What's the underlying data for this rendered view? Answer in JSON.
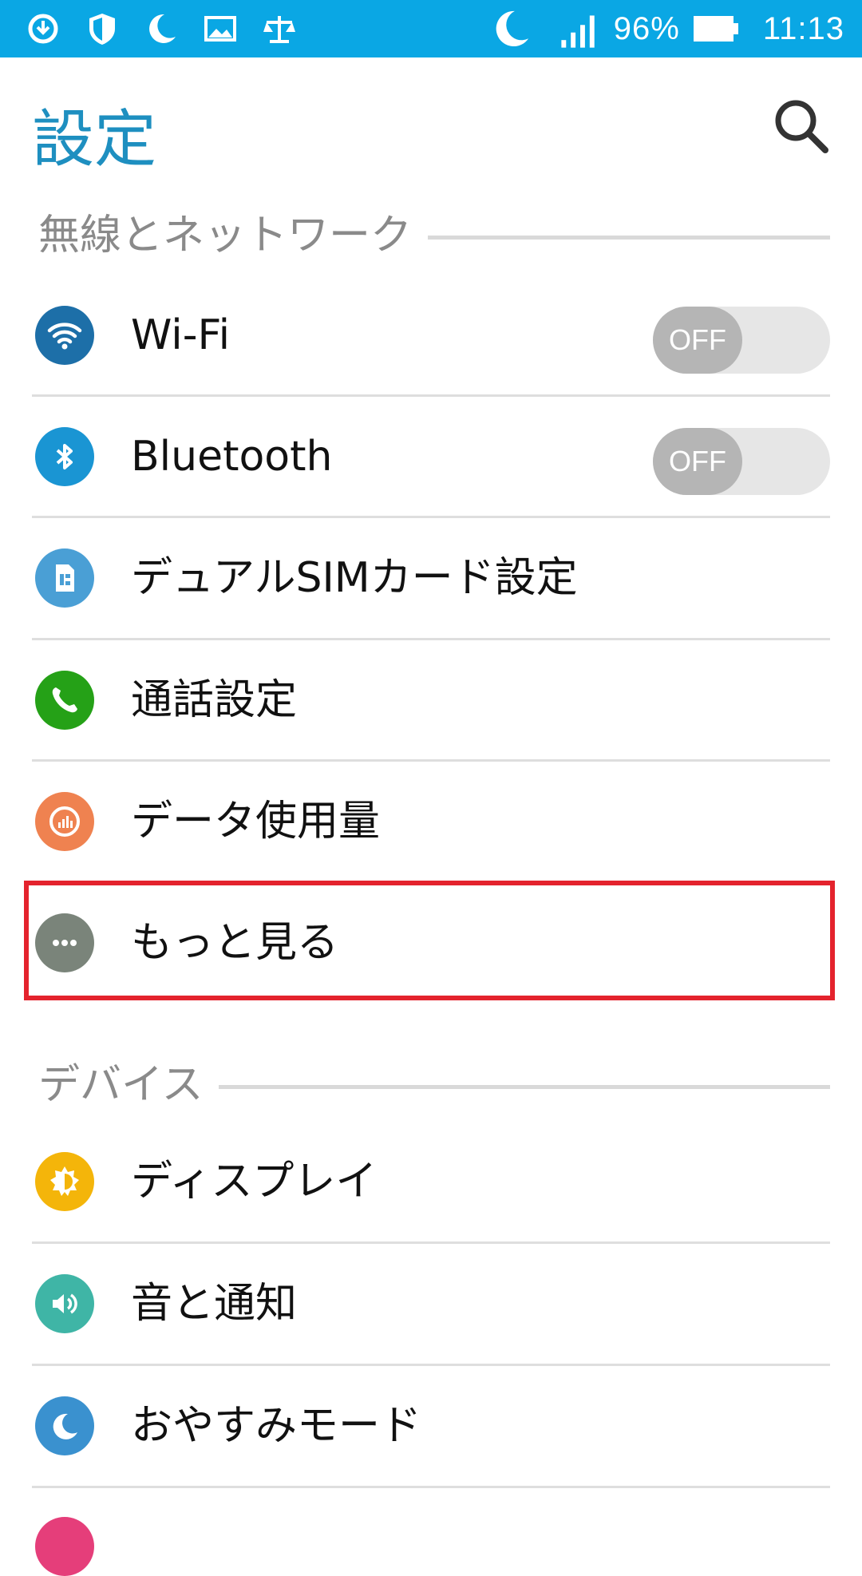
{
  "status_bar": {
    "left_icons": [
      "download-icon",
      "shield-icon",
      "moon-icon",
      "image-icon",
      "scale-icon"
    ],
    "battery_percent": "96%",
    "time": "11:13",
    "color": "#0aa7e4"
  },
  "header": {
    "title": "設定",
    "title_color": "#1e8fc0",
    "search_icon": "search-icon"
  },
  "sections": [
    {
      "label": "無線とネットワーク",
      "items": [
        {
          "label": "Wi-Fi",
          "icon": "wifi-icon",
          "icon_color": "#1d6fa8",
          "toggle": "OFF"
        },
        {
          "label": "Bluetooth",
          "icon": "bluetooth-icon",
          "icon_color": "#1a95d3",
          "toggle": "OFF"
        },
        {
          "label": "デュアルSIMカード設定",
          "icon": "sim-card-icon",
          "icon_color": "#4a9fd5"
        },
        {
          "label": "通話設定",
          "icon": "phone-icon",
          "icon_color": "#25a117"
        },
        {
          "label": "データ使用量",
          "icon": "data-usage-icon",
          "icon_color": "#ef8250"
        },
        {
          "label": "もっと見る",
          "icon": "more-dots-icon",
          "icon_color": "#7a847a",
          "highlighted": true
        }
      ]
    },
    {
      "label": "デバイス",
      "items": [
        {
          "label": "ディスプレイ",
          "icon": "display-brightness-icon",
          "icon_color": "#f4b50a"
        },
        {
          "label": "音と通知",
          "icon": "sound-icon",
          "icon_color": "#3fb5a6"
        },
        {
          "label": "おやすみモード",
          "icon": "moon-icon",
          "icon_color": "#3a91cf"
        }
      ]
    }
  ],
  "highlight_color": "#e4232d"
}
